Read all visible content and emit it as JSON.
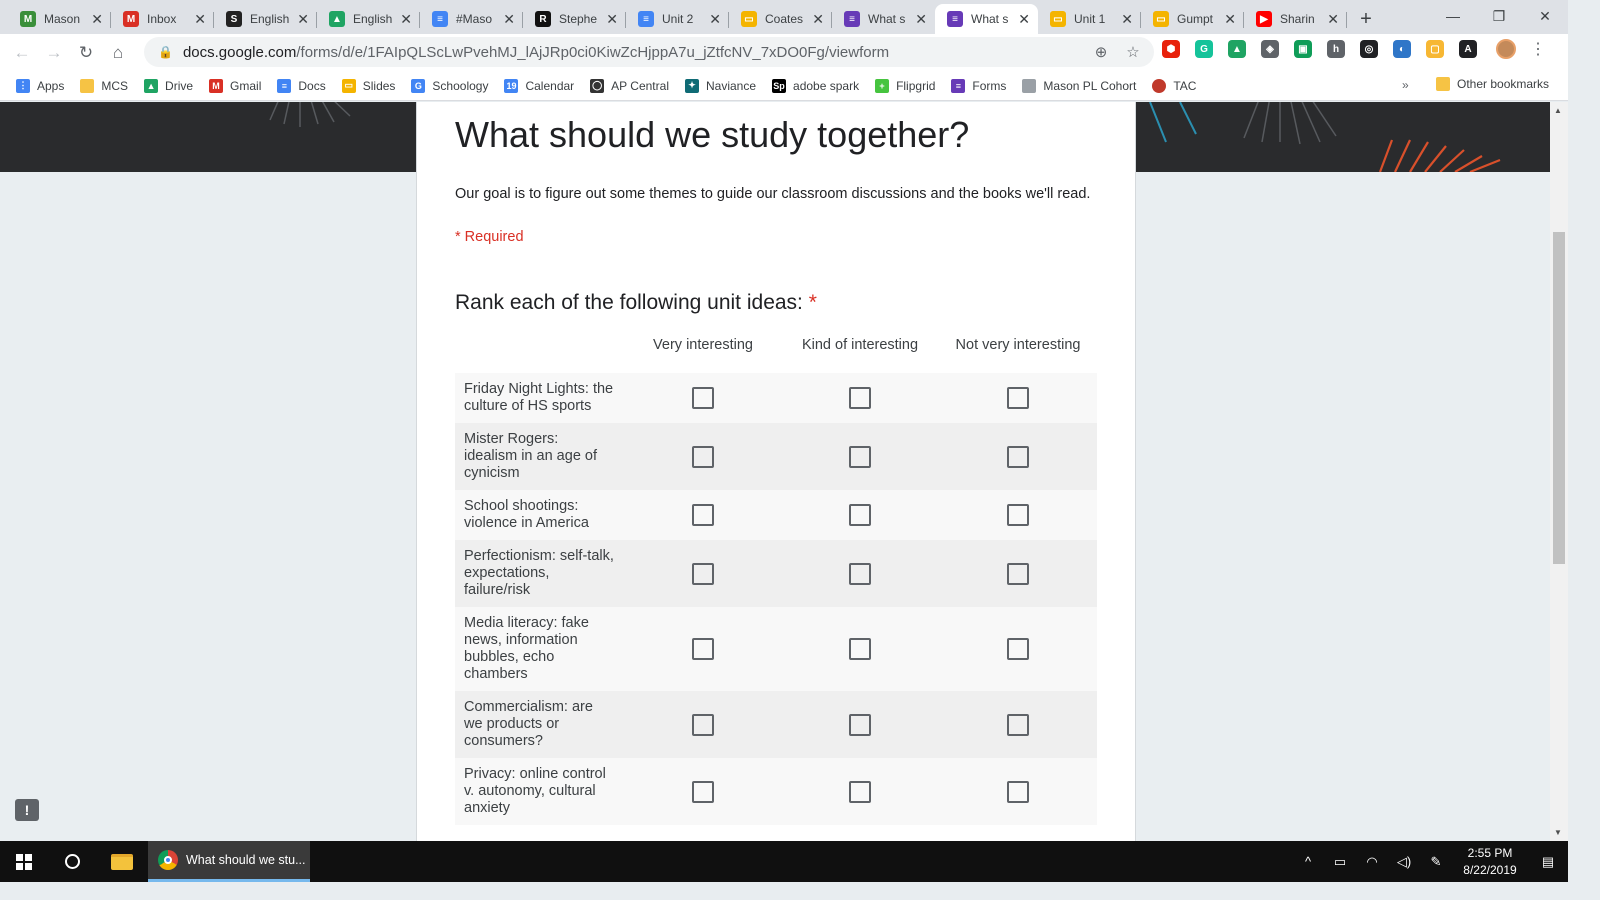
{
  "tabs": [
    {
      "title": "Mason",
      "icon": "mason-icon",
      "color": "#3a8f3a",
      "glyph": "M"
    },
    {
      "title": "Inbox",
      "icon": "gmail-icon",
      "color": "#d93025",
      "glyph": "M"
    },
    {
      "title": "English",
      "icon": "schoology-icon",
      "color": "#222222",
      "glyph": "S"
    },
    {
      "title": "English",
      "icon": "drive-icon",
      "color": "#1fa463",
      "glyph": "▲"
    },
    {
      "title": "#Maso",
      "icon": "docs-icon",
      "color": "#4285f4",
      "glyph": "≡"
    },
    {
      "title": "Stephe",
      "icon": "r-icon",
      "color": "#111111",
      "glyph": "R"
    },
    {
      "title": "Unit 2",
      "icon": "docs-icon",
      "color": "#4285f4",
      "glyph": "≡"
    },
    {
      "title": "Coates",
      "icon": "slides-icon",
      "color": "#f4b400",
      "glyph": "▭"
    },
    {
      "title": "What s",
      "icon": "forms-icon",
      "color": "#673ab7",
      "glyph": "≡"
    },
    {
      "title": "What s",
      "icon": "forms-icon",
      "color": "#673ab7",
      "glyph": "≡",
      "active": true
    },
    {
      "title": "Unit 1",
      "icon": "slides-icon",
      "color": "#f4b400",
      "glyph": "▭"
    },
    {
      "title": "Gumpt",
      "icon": "slides-icon",
      "color": "#f4b400",
      "glyph": "▭"
    },
    {
      "title": "Sharin",
      "icon": "youtube-icon",
      "color": "#ff0000",
      "glyph": "▶"
    }
  ],
  "toolbar": {
    "url_host": "docs.google.com",
    "url_path": "/forms/d/e/1FAIpQLScLwPvehMJ_lAjJRp0ci0KiwZcHjppA7u_jZtfcNV_7xDO0Fg/viewform"
  },
  "extensions": [
    {
      "name": "adblock-icon",
      "color": "#e8210b",
      "glyph": "⬢"
    },
    {
      "name": "grammarly-icon",
      "color": "#15c39a",
      "glyph": "G"
    },
    {
      "name": "drive-ext-icon",
      "color": "#1fa463",
      "glyph": "▲"
    },
    {
      "name": "keep-ext-icon",
      "color": "#5f6368",
      "glyph": "◈"
    },
    {
      "name": "classroom-ext-icon",
      "color": "#0f9d58",
      "glyph": "▣"
    },
    {
      "name": "h-ext-icon",
      "color": "#5f6368",
      "glyph": "h"
    },
    {
      "name": "spiral-ext-icon",
      "color": "#202124",
      "glyph": "◎"
    },
    {
      "name": "edpuzzle-ext-icon",
      "color": "#2f76c8",
      "glyph": "◐"
    },
    {
      "name": "screencast-ext-icon",
      "color": "#f7b733",
      "glyph": "▢"
    },
    {
      "name": "a-ext-icon",
      "color": "#202124",
      "glyph": "A"
    }
  ],
  "bookmarks": [
    {
      "label": "Apps",
      "icon": "apps-grid-icon",
      "color": "#4285f4",
      "glyph": "⋮"
    },
    {
      "label": "MCS",
      "icon": "folder-icon",
      "color": "#f6c344",
      "glyph": ""
    },
    {
      "label": "Drive",
      "icon": "drive-icon",
      "color": "#1fa463",
      "glyph": "▲"
    },
    {
      "label": "Gmail",
      "icon": "gmail-icon",
      "color": "#d93025",
      "glyph": "M"
    },
    {
      "label": "Docs",
      "icon": "docs-icon",
      "color": "#4285f4",
      "glyph": "≡"
    },
    {
      "label": "Slides",
      "icon": "slides-icon",
      "color": "#f4b400",
      "glyph": "▭"
    },
    {
      "label": "Schoology",
      "icon": "google-icon",
      "color": "#4285f4",
      "glyph": "G"
    },
    {
      "label": "Calendar",
      "icon": "calendar-icon",
      "color": "#4285f4",
      "glyph": "19"
    },
    {
      "label": "AP Central",
      "icon": "ap-icon",
      "color": "#333333",
      "glyph": "◯"
    },
    {
      "label": "Naviance",
      "icon": "naviance-icon",
      "color": "#0f6b75",
      "glyph": "✦"
    },
    {
      "label": "adobe spark",
      "icon": "spark-icon",
      "color": "#000000",
      "glyph": "Sp"
    },
    {
      "label": "Flipgrid",
      "icon": "flipgrid-icon",
      "color": "#46c43f",
      "glyph": "+"
    },
    {
      "label": "Forms",
      "icon": "forms-icon",
      "color": "#673ab7",
      "glyph": "≡"
    },
    {
      "label": "Mason PL Cohort",
      "icon": "image-icon",
      "color": "#9aa0a6",
      "glyph": ""
    },
    {
      "label": "TAC",
      "icon": "tac-icon",
      "color": "#c0392b",
      "glyph": ""
    }
  ],
  "bookmarks_more": "»",
  "other_bookmarks": "Other bookmarks",
  "form": {
    "title": "What should we study together?",
    "description": "Our goal is to figure out some themes to guide our classroom discussions and the books we'll read.",
    "required_note": "* Required",
    "question": "Rank each of the following unit ideas:",
    "required_mark": "*",
    "columns": [
      "Very interesting",
      "Kind of interesting",
      "Not very interesting"
    ],
    "rows": [
      "Friday Night Lights: the culture of HS sports",
      "Mister Rogers: idealism in an age of cynicism",
      "School shootings: violence in America",
      "Perfectionism: self-talk, expectations, failure/risk",
      "Media literacy: fake news, information bubbles, echo chambers",
      "Commercialism: are we products or consumers?",
      "Privacy: online control v. autonomy, cultural anxiety"
    ]
  },
  "taskbar": {
    "app_title": "What should we stu...",
    "time": "2:55 PM",
    "date": "8/22/2019"
  }
}
